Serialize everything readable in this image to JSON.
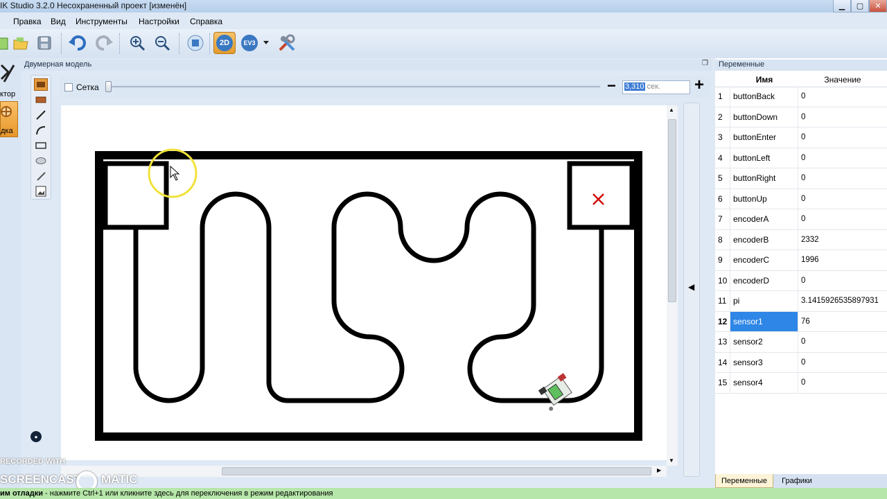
{
  "window": {
    "title": "IK Studio 3.2.0 Несохраненный проект [изменён]"
  },
  "menu": [
    "Правка",
    "Вид",
    "Инструменты",
    "Настройки",
    "Справка"
  ],
  "toolbar": {
    "mode_2d_label": "2D",
    "ev3_label": "EV3"
  },
  "left_dock": {
    "editor_label": "ктор",
    "debug_label": "дка"
  },
  "model_panel": {
    "title": "Двумерная модель",
    "grid_label": "Сетка",
    "grid_checked": false,
    "time_value": "3,310",
    "time_unit": " сек.",
    "minus": "−",
    "plus": "+"
  },
  "variables_panel": {
    "title": "Переменные",
    "col_name": "Имя",
    "col_value": "Значение",
    "rows": [
      {
        "n": "1",
        "name": "buttonBack",
        "value": "0"
      },
      {
        "n": "2",
        "name": "buttonDown",
        "value": "0"
      },
      {
        "n": "3",
        "name": "buttonEnter",
        "value": "0"
      },
      {
        "n": "4",
        "name": "buttonLeft",
        "value": "0"
      },
      {
        "n": "5",
        "name": "buttonRight",
        "value": "0"
      },
      {
        "n": "6",
        "name": "buttonUp",
        "value": "0"
      },
      {
        "n": "7",
        "name": "encoderA",
        "value": "0"
      },
      {
        "n": "8",
        "name": "encoderB",
        "value": "2332"
      },
      {
        "n": "9",
        "name": "encoderC",
        "value": "1996"
      },
      {
        "n": "10",
        "name": "encoderD",
        "value": "0"
      },
      {
        "n": "11",
        "name": "pi",
        "value": "3.1415926535897931"
      },
      {
        "n": "12",
        "name": "sensor1",
        "value": "76"
      },
      {
        "n": "13",
        "name": "sensor2",
        "value": "0"
      },
      {
        "n": "14",
        "name": "sensor3",
        "value": "0"
      },
      {
        "n": "15",
        "name": "sensor4",
        "value": "0"
      }
    ],
    "selected_row": "12",
    "tabs": {
      "variables": "Переменные",
      "graphs": "Графики"
    }
  },
  "watermark": {
    "line1": "RECORDED WITH",
    "line2": "SCREENCAST",
    "line3": "MATIC"
  },
  "statusbar": {
    "bold_part": "им отладки",
    "rest": " - нажмите Ctrl+1 или кликните здесь для переключения в режим редактирования"
  }
}
